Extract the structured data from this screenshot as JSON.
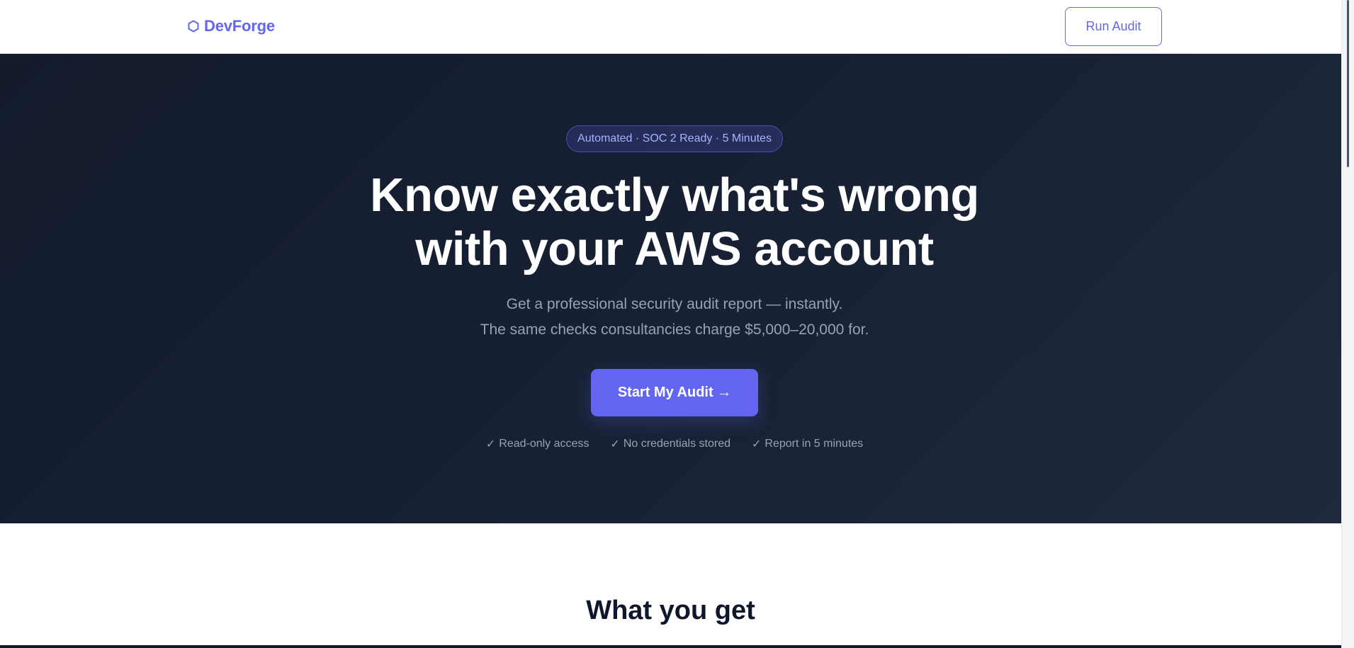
{
  "header": {
    "logo_text": "DevForge",
    "logo_icon": "hexagon-icon",
    "cta_label": "Run Audit"
  },
  "hero": {
    "badge": "Automated · SOC 2 Ready · 5 Minutes",
    "title_line1": "Know exactly what's wrong",
    "title_line2": "with your AWS account",
    "subtitle_line1": "Get a professional security audit report — instantly.",
    "subtitle_line2": "The same checks consultancies charge $5,000–20,000 for.",
    "cta_label": "Start My Audit →",
    "trust_items": [
      {
        "check": "✓",
        "label": "Read-only access"
      },
      {
        "check": "✓",
        "label": "No credentials stored"
      },
      {
        "check": "✓",
        "label": "Report in 5 minutes"
      }
    ]
  },
  "features": {
    "title": "What you get"
  },
  "colors": {
    "brand": "#6366f1",
    "hero_bg": "#172033",
    "text_muted": "#94a3b8",
    "badge_text": "#a5b4fc"
  }
}
